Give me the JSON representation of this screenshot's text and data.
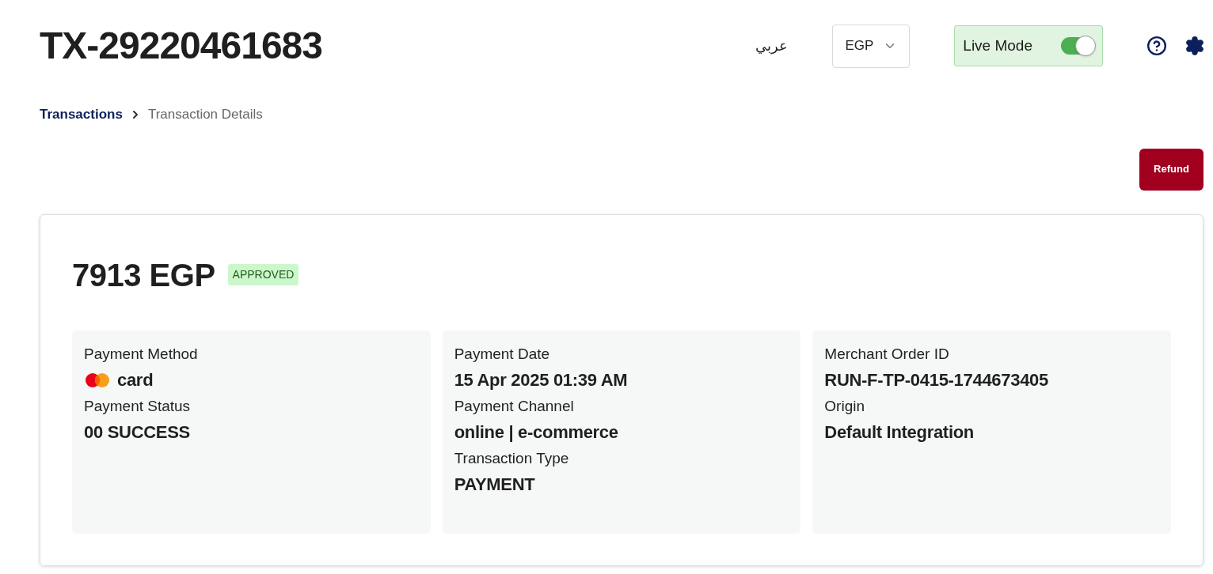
{
  "header": {
    "title": "TX-29220461683",
    "language": "عربي",
    "currency": "EGP",
    "live_mode": {
      "label": "Live Mode",
      "on": true
    }
  },
  "breadcrumb": [
    {
      "label": "Transactions",
      "current": false
    },
    {
      "label": "Transaction Details",
      "current": true
    }
  ],
  "actions": [
    "Refund"
  ],
  "summary": {
    "amount": "7913 EGP",
    "status": "APPROVED"
  },
  "panels": [
    {
      "fields": [
        {
          "label": "Payment Method",
          "value": "card",
          "kind": "card"
        },
        {
          "label": "Payment Status",
          "value": "00 SUCCESS",
          "kind": "text"
        }
      ]
    },
    {
      "fields": [
        {
          "label": "Payment Date",
          "value": "15 Apr 2025 01:39 AM",
          "kind": "text"
        },
        {
          "label": "Payment Channel",
          "value": "online | e-commerce",
          "kind": "text"
        },
        {
          "label": "Transaction Type",
          "value": "PAYMENT",
          "kind": "text"
        }
      ]
    },
    {
      "fields": [
        {
          "label": "Merchant Order ID",
          "value": "RUN-F-TP-0415-1744673405",
          "kind": "text"
        },
        {
          "label": "Origin",
          "value": "Default Integration",
          "kind": "text"
        }
      ]
    }
  ]
}
